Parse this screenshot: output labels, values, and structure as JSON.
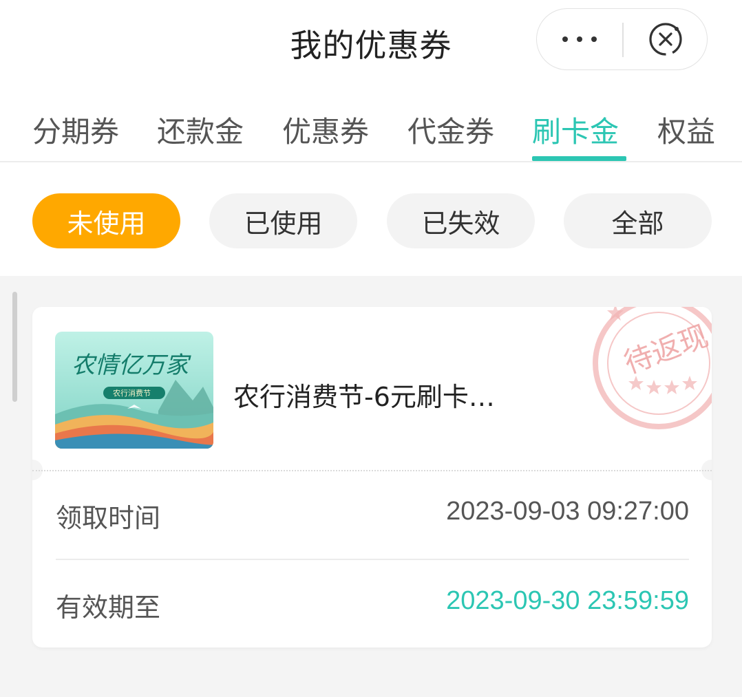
{
  "header": {
    "title": "我的优惠券",
    "more_icon": "more-dots-icon",
    "close_icon": "close-circle-icon"
  },
  "tabs": [
    {
      "label": "分期券",
      "active": false
    },
    {
      "label": "还款金",
      "active": false
    },
    {
      "label": "优惠券",
      "active": false
    },
    {
      "label": "代金券",
      "active": false
    },
    {
      "label": "刷卡金",
      "active": true
    },
    {
      "label": "权益",
      "active": false
    }
  ],
  "filters": [
    {
      "label": "未使用",
      "active": true
    },
    {
      "label": "已使用",
      "active": false
    },
    {
      "label": "已失效",
      "active": false
    },
    {
      "label": "全部",
      "active": false
    }
  ],
  "coupon": {
    "name": "农行消费节-6元刷卡…",
    "stamp_text": "待返现",
    "thumbnail_title": "农情亿万家",
    "thumbnail_subtitle": "农行消费节",
    "received_label": "领取时间",
    "received_value": "2023-09-03 09:27:00",
    "expiry_label": "有效期至",
    "expiry_value": "2023-09-30 23:59:59"
  },
  "colors": {
    "accent": "#2cc6b3",
    "active_chip": "#ffa800",
    "stamp": "#f2b8b8"
  }
}
